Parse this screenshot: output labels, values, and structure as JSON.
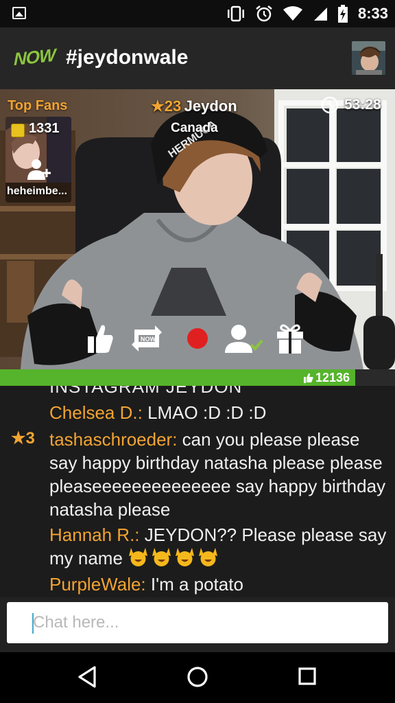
{
  "status_bar": {
    "time": "8:33",
    "icons": [
      "gallery-icon",
      "vibrate-icon",
      "alarm-icon",
      "wifi-icon",
      "signal-icon",
      "battery-charging-icon"
    ]
  },
  "app_bar": {
    "logo": "NOW",
    "title": "#jeydonwale"
  },
  "broadcast": {
    "top_fans_label": "Top Fans",
    "top_fan": {
      "coins": "1331",
      "name": "heheimbe..."
    },
    "host": {
      "rank": "★23",
      "name": "Jeydon",
      "country": "Canada"
    },
    "duration": "53:28",
    "controls": [
      "like-button",
      "share-button",
      "record-button",
      "follow-button",
      "gift-button"
    ],
    "likes": "12136",
    "likes_progress": 0.9
  },
  "chat": {
    "cut_line": "INSTAGRAM JEYDON",
    "messages": [
      {
        "rank": "",
        "user": "Chelsea D.:",
        "text": " LMAO :D :D :D"
      },
      {
        "rank": "★3",
        "user": "tashaschroeder:",
        "text": " can you please please say happy birthday natasha please please pleaseeeeeeeeeeeeee say happy birthday natasha please"
      },
      {
        "rank": "",
        "user": "Hannah R.:",
        "text": " JEYDON?? Please please say my name"
      },
      {
        "rank": "",
        "user": "PurpleWale:",
        "text": " I'm a potato"
      }
    ],
    "emoji_count": 4,
    "input_placeholder": "Chat here..."
  },
  "colors": {
    "accent_orange": "#f2a431",
    "brand_green": "#8bc53f",
    "likes_green": "#55b42b",
    "record_red": "#e02020"
  }
}
